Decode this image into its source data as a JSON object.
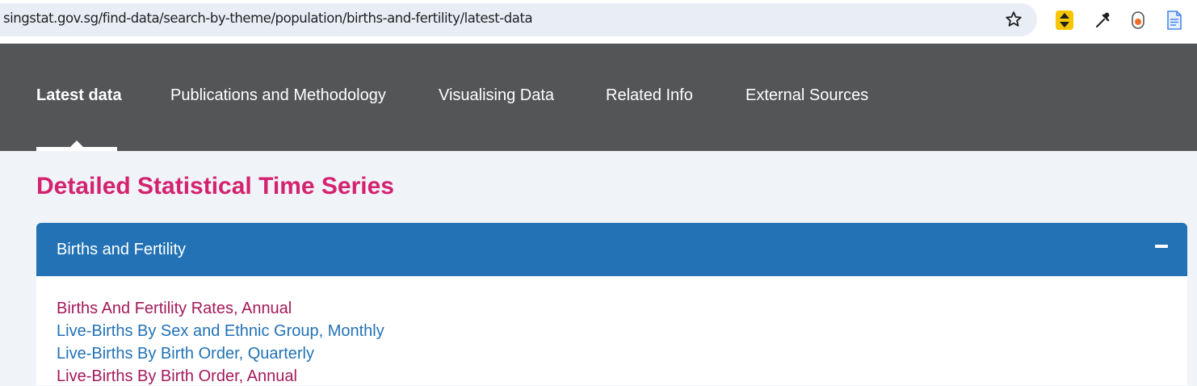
{
  "browser": {
    "url": "singstat.gov.sg/find-data/search-by-theme/population/births-and-fertility/latest-data",
    "icons": [
      "star-icon",
      "extension-arrows-icon",
      "eyedropper-icon",
      "extension-orange-dot-icon",
      "document-icon"
    ]
  },
  "nav": {
    "items": [
      {
        "label": "Latest data",
        "active": true
      },
      {
        "label": "Publications and Methodology",
        "active": false
      },
      {
        "label": "Visualising Data",
        "active": false
      },
      {
        "label": "Related Info",
        "active": false
      },
      {
        "label": "External Sources",
        "active": false
      }
    ]
  },
  "main": {
    "title": "Detailed Statistical Time Series",
    "accordion": {
      "title": "Births and Fertility",
      "toggle_icon": "minus-icon",
      "links": [
        {
          "label": "Births And Fertility Rates, Annual",
          "color": "#a3195b"
        },
        {
          "label": "Live-Births By Sex and Ethnic Group, Monthly",
          "color": "#2272b5"
        },
        {
          "label": "Live-Births By Birth Order, Quarterly",
          "color": "#2272b5"
        },
        {
          "label": "Live-Births By Birth Order, Annual",
          "color": "#a3195b"
        }
      ]
    }
  },
  "colors": {
    "nav_bg": "#545557",
    "title": "#d3226f",
    "accordion_header": "#2272b5",
    "page_bg": "#f0f3f7"
  }
}
